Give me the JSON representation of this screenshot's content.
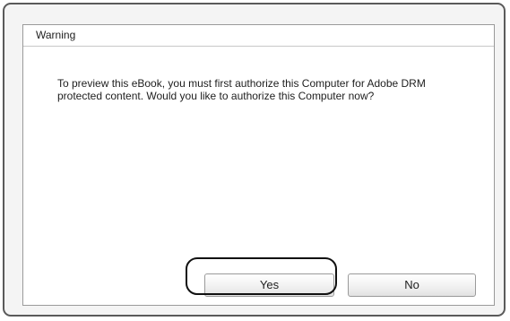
{
  "dialog": {
    "title": "Warning",
    "message": "To preview this eBook, you must first authorize this Computer for Adobe DRM protected content. Would you like to authorize this Computer now?",
    "buttons": {
      "yes_label": "Yes",
      "no_label": "No"
    }
  }
}
